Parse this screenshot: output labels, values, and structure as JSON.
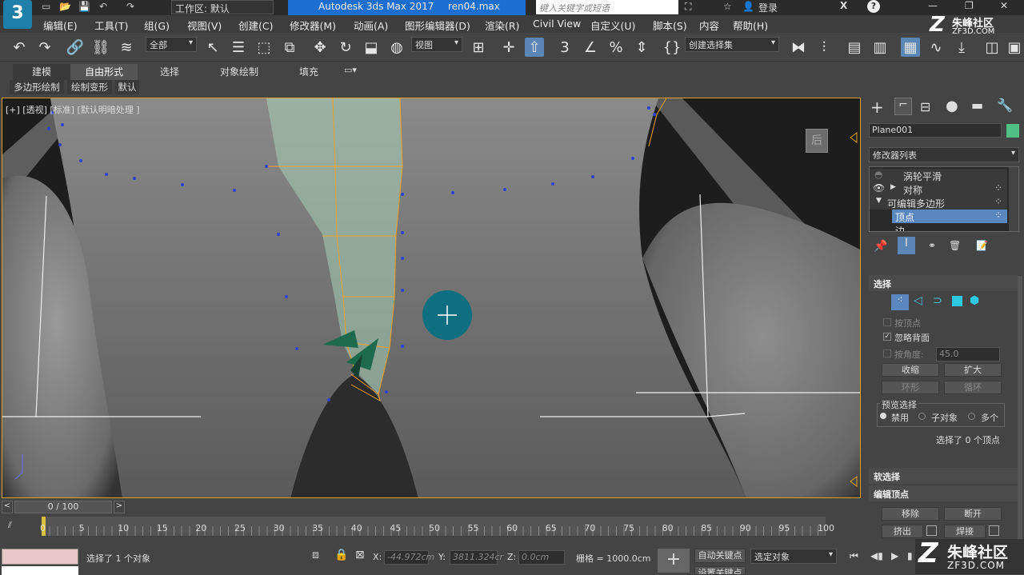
{
  "title": {
    "app": "Autodesk 3ds Max 2017",
    "file": "ren04.max",
    "workspace": "工作区: 默认",
    "search_placeholder": "键入关键字或短语",
    "login": "登录"
  },
  "menu": [
    "编辑(E)",
    "工具(T)",
    "组(G)",
    "视图(V)",
    "创建(C)",
    "修改器(M)",
    "动画(A)",
    "图形编辑器(D)",
    "渲染(R)",
    "Civil View",
    "自定义(U)",
    "脚本(S)",
    "内容",
    "帮助(H)"
  ],
  "toolbar": {
    "filter": "全部",
    "coord": "视图",
    "selset": "创建选择集"
  },
  "ribbon": {
    "tabs": [
      "建模",
      "自由形式",
      "选择",
      "对象绘制",
      "填充"
    ],
    "subtabs": [
      "多边形绘制",
      "绘制变形",
      "默认"
    ]
  },
  "viewport": {
    "label": "[+] [透视] [标准] [默认明暗处理 ]",
    "cube_label": "后"
  },
  "panel": {
    "object_name": "Plane001",
    "modifier_list": "修改器列表",
    "stack": [
      "涡轮平滑",
      "对称",
      "可编辑多边形",
      "顶点",
      "边"
    ],
    "sections": {
      "select": "选择",
      "soft": "软选择",
      "edit_vertex": "编辑顶点"
    },
    "by_vertex": "按顶点",
    "ignore_back": "忽略背面",
    "by_angle": "按角度:",
    "angle_value": "45.0",
    "shrink": "收缩",
    "grow": "扩大",
    "ring": "环形",
    "loop": "循环",
    "preview": "预览选择",
    "preview_opts": [
      "禁用",
      "子对象",
      "多个"
    ],
    "selected_info": "选择了 0 个顶点",
    "remove": "移除",
    "break": "断开",
    "extrude": "挤出",
    "weld": "焊接"
  },
  "timeline": {
    "frame": "0 / 100",
    "ticks": [
      "0",
      "5",
      "10",
      "15",
      "20",
      "25",
      "30",
      "35",
      "40",
      "45",
      "50",
      "55",
      "60",
      "65",
      "70",
      "75",
      "80",
      "85",
      "90",
      "95",
      "100"
    ]
  },
  "status": {
    "selected": "选择了 1 个对象",
    "x_label": "X:",
    "x": "-44.972cm",
    "y_label": "Y:",
    "y": "3811.324cr",
    "z_label": "Z:",
    "z": "0.0cm",
    "grid": "栅格 = 1000.0cm",
    "autokey": "自动关键点",
    "setkey": "设置关键点",
    "sel_obj": "选定对象",
    "watermark": "朱峰社区",
    "watermark_url": "ZF3D.COM"
  },
  "watermark_top": {
    "name": "朱峰社区",
    "url": "ZF3D.COM"
  }
}
